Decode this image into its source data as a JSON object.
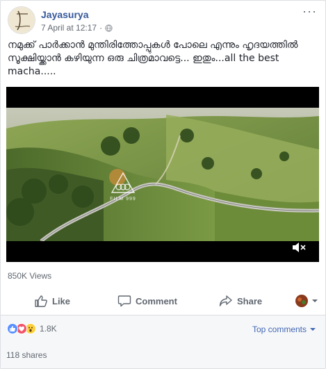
{
  "post": {
    "author": "Jayasurya",
    "timestamp": "7 April at 12:17",
    "more_label": "···",
    "text": "നമുക്ക് പാർക്കാൻ മുന്തിരിത്തോപ്പുകൾ പോലെ എന്നും ഹൃദയത്തിൽ സൂക്ഷിയ്ക്കാൻ കഴിയുന്ന ഒരു ചിത്രമാവട്ടെ... ഇതും...all the best macha....."
  },
  "video": {
    "watermark": "FILM 999",
    "views": "850K Views"
  },
  "actions": {
    "like_label": "Like",
    "comment_label": "Comment",
    "share_label": "Share"
  },
  "footer": {
    "reaction_count": "1.8K",
    "top_comments_label": "Top comments",
    "shares_label": "118 shares"
  },
  "colors": {
    "link_blue": "#365899",
    "accent_blue": "#4267b2",
    "like_blue": "#5890ff",
    "love_red": "#f25268",
    "wow_yellow": "#fcd13f"
  }
}
